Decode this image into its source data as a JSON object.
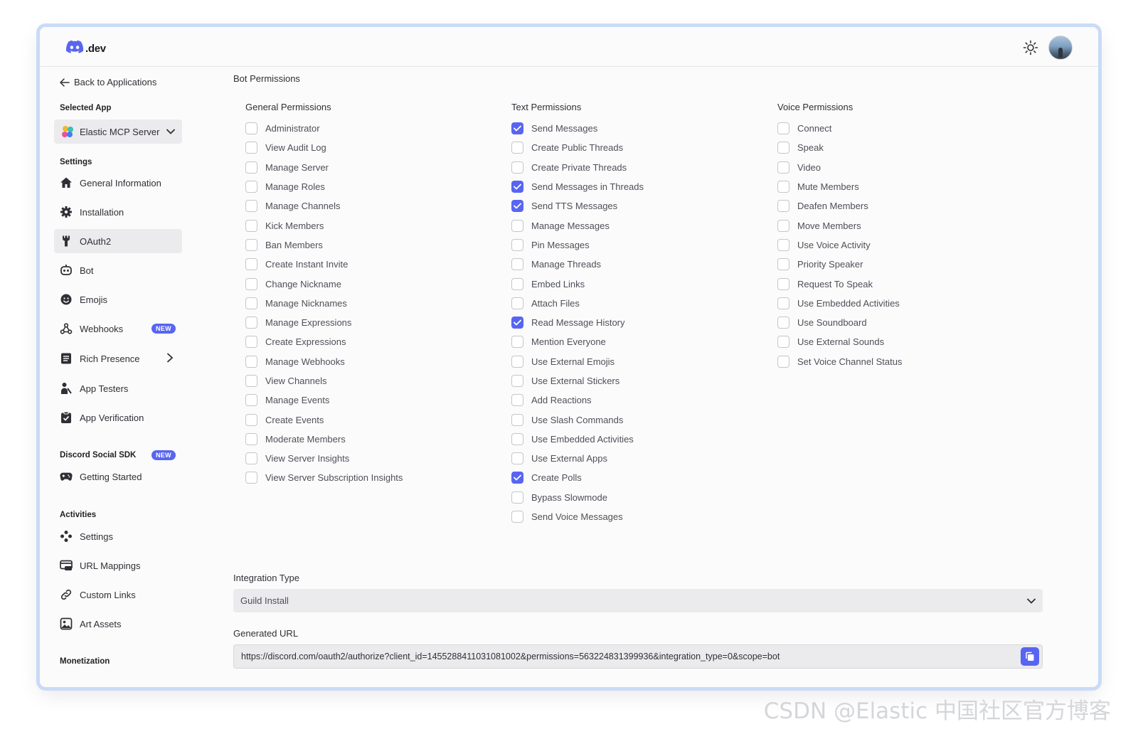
{
  "brand": {
    "logo_text": ".dev",
    "accent": "#5865f2"
  },
  "header": {
    "theme_icon": "sun-icon",
    "avatar": "user-avatar"
  },
  "sidebar": {
    "back_label": "Back to Applications",
    "selected_app_label": "Selected App",
    "selected_app": "Elastic MCP Server",
    "settings_label": "Settings",
    "settings_items": [
      {
        "label": "General Information",
        "icon": "home-icon"
      },
      {
        "label": "Installation",
        "icon": "gear-icon"
      },
      {
        "label": "OAuth2",
        "icon": "wrench-icon",
        "active": true
      },
      {
        "label": "Bot",
        "icon": "robot-icon"
      },
      {
        "label": "Emojis",
        "icon": "smile-icon"
      },
      {
        "label": "Webhooks",
        "icon": "webhook-icon",
        "badge": "NEW"
      },
      {
        "label": "Rich Presence",
        "icon": "document-icon",
        "has_arrow": true
      },
      {
        "label": "App Testers",
        "icon": "user-icon"
      },
      {
        "label": "App Verification",
        "icon": "clipboard-check-icon"
      }
    ],
    "social_sdk_label": "Discord Social SDK",
    "social_sdk_badge": "NEW",
    "social_sdk_items": [
      {
        "label": "Getting Started",
        "icon": "gamepad-icon"
      }
    ],
    "activities_label": "Activities",
    "activities_items": [
      {
        "label": "Settings",
        "icon": "sliders-icon"
      },
      {
        "label": "URL Mappings",
        "icon": "url-icon"
      },
      {
        "label": "Custom Links",
        "icon": "link-icon"
      },
      {
        "label": "Art Assets",
        "icon": "image-icon"
      }
    ],
    "monetization_label": "Monetization"
  },
  "main": {
    "title": "Bot Permissions",
    "columns": [
      {
        "heading": "General Permissions",
        "items": [
          {
            "label": "Administrator",
            "checked": false
          },
          {
            "label": "View Audit Log",
            "checked": false
          },
          {
            "label": "Manage Server",
            "checked": false
          },
          {
            "label": "Manage Roles",
            "checked": false
          },
          {
            "label": "Manage Channels",
            "checked": false
          },
          {
            "label": "Kick Members",
            "checked": false
          },
          {
            "label": "Ban Members",
            "checked": false
          },
          {
            "label": "Create Instant Invite",
            "checked": false
          },
          {
            "label": "Change Nickname",
            "checked": false
          },
          {
            "label": "Manage Nicknames",
            "checked": false
          },
          {
            "label": "Manage Expressions",
            "checked": false
          },
          {
            "label": "Create Expressions",
            "checked": false
          },
          {
            "label": "Manage Webhooks",
            "checked": false
          },
          {
            "label": "View Channels",
            "checked": false
          },
          {
            "label": "Manage Events",
            "checked": false
          },
          {
            "label": "Create Events",
            "checked": false
          },
          {
            "label": "Moderate Members",
            "checked": false
          },
          {
            "label": "View Server Insights",
            "checked": false
          },
          {
            "label": "View Server Subscription Insights",
            "checked": false
          }
        ]
      },
      {
        "heading": "Text Permissions",
        "items": [
          {
            "label": "Send Messages",
            "checked": true
          },
          {
            "label": "Create Public Threads",
            "checked": false
          },
          {
            "label": "Create Private Threads",
            "checked": false
          },
          {
            "label": "Send Messages in Threads",
            "checked": true
          },
          {
            "label": "Send TTS Messages",
            "checked": true
          },
          {
            "label": "Manage Messages",
            "checked": false
          },
          {
            "label": "Pin Messages",
            "checked": false
          },
          {
            "label": "Manage Threads",
            "checked": false
          },
          {
            "label": "Embed Links",
            "checked": false
          },
          {
            "label": "Attach Files",
            "checked": false
          },
          {
            "label": "Read Message History",
            "checked": true
          },
          {
            "label": "Mention Everyone",
            "checked": false
          },
          {
            "label": "Use External Emojis",
            "checked": false
          },
          {
            "label": "Use External Stickers",
            "checked": false
          },
          {
            "label": "Add Reactions",
            "checked": false
          },
          {
            "label": "Use Slash Commands",
            "checked": false
          },
          {
            "label": "Use Embedded Activities",
            "checked": false
          },
          {
            "label": "Use External Apps",
            "checked": false
          },
          {
            "label": "Create Polls",
            "checked": true
          },
          {
            "label": "Bypass Slowmode",
            "checked": false
          },
          {
            "label": "Send Voice Messages",
            "checked": false
          }
        ]
      },
      {
        "heading": "Voice Permissions",
        "items": [
          {
            "label": "Connect",
            "checked": false
          },
          {
            "label": "Speak",
            "checked": false
          },
          {
            "label": "Video",
            "checked": false
          },
          {
            "label": "Mute Members",
            "checked": false
          },
          {
            "label": "Deafen Members",
            "checked": false
          },
          {
            "label": "Move Members",
            "checked": false
          },
          {
            "label": "Use Voice Activity",
            "checked": false
          },
          {
            "label": "Priority Speaker",
            "checked": false
          },
          {
            "label": "Request To Speak",
            "checked": false
          },
          {
            "label": "Use Embedded Activities",
            "checked": false
          },
          {
            "label": "Use Soundboard",
            "checked": false
          },
          {
            "label": "Use External Sounds",
            "checked": false
          },
          {
            "label": "Set Voice Channel Status",
            "checked": false
          }
        ]
      }
    ],
    "integration_type_label": "Integration Type",
    "integration_type_value": "Guild Install",
    "generated_url_label": "Generated URL",
    "generated_url": "https://discord.com/oauth2/authorize?client_id=1455288411031081002&permissions=563224831399936&integration_type=0&scope=bot"
  },
  "watermark": "CSDN @Elastic 中国社区官方博客"
}
